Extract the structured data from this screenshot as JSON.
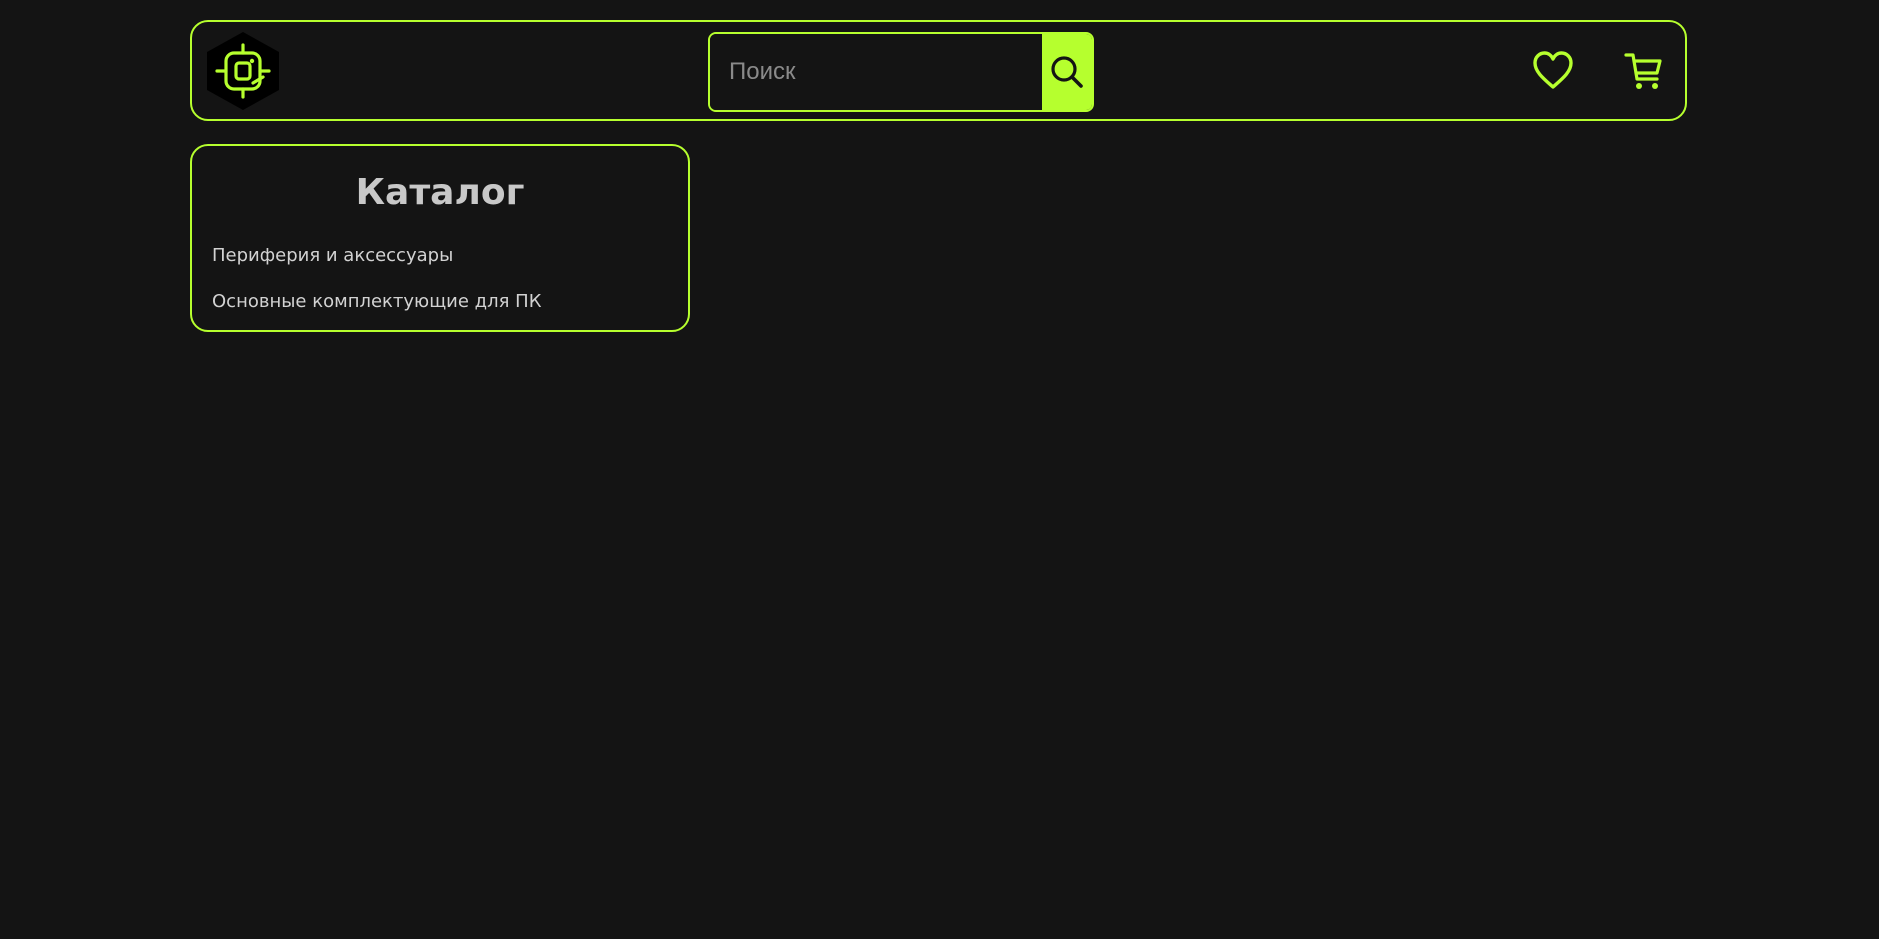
{
  "colors": {
    "accent": "#b6ff2e",
    "background": "#141414",
    "text": "#d2d2d2",
    "title": "#c8c8c8"
  },
  "header": {
    "logo_icon": "chip-hexagon-logo",
    "search": {
      "placeholder": "Поиск",
      "value": "",
      "button_icon": "search-icon"
    },
    "favorites_icon": "heart-icon",
    "cart_icon": "cart-icon"
  },
  "catalog": {
    "title": "Каталог",
    "items": [
      {
        "label": "Периферия и аксессуары"
      },
      {
        "label": "Основные комплектующие для ПК"
      }
    ]
  }
}
